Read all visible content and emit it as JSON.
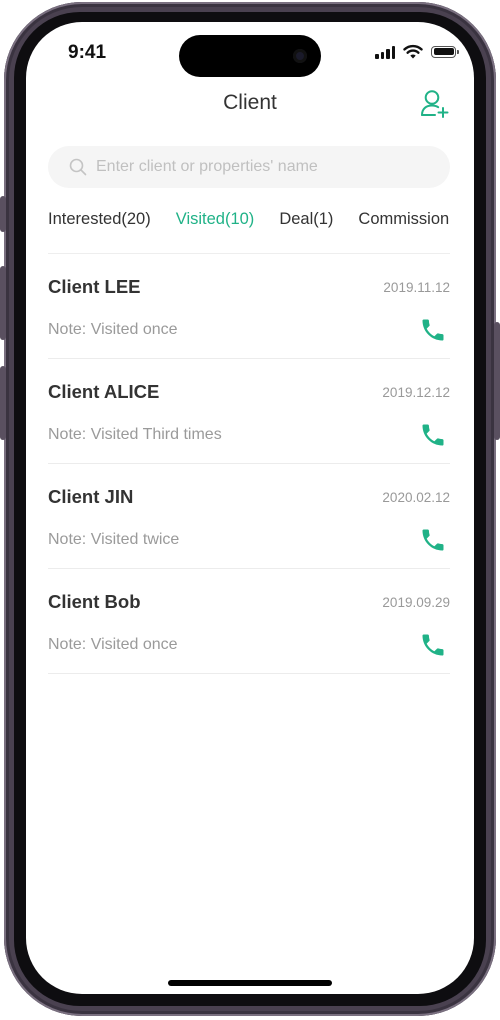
{
  "status_bar": {
    "time": "9:41"
  },
  "header": {
    "title": "Client",
    "add_client_icon": "person-add-icon"
  },
  "search": {
    "placeholder": "Enter client or properties' name",
    "value": ""
  },
  "tabs": [
    {
      "label": "Interested(20)",
      "active": false
    },
    {
      "label": "Visited(10)",
      "active": true
    },
    {
      "label": "Deal(1)",
      "active": false
    },
    {
      "label": "Commission",
      "active": false
    }
  ],
  "clients": [
    {
      "name": "Client LEE",
      "date": "2019.11.12",
      "note": "Note: Visited once"
    },
    {
      "name": "Client ALICE",
      "date": "2019.12.12",
      "note": "Note: Visited Third times"
    },
    {
      "name": "Client JIN",
      "date": "2020.02.12",
      "note": "Note: Visited twice"
    },
    {
      "name": "Client Bob",
      "date": "2019.09.29",
      "note": "Note: Visited once"
    }
  ],
  "colors": {
    "accent": "#20b287",
    "text_primary": "#333333",
    "text_secondary": "#9a9a9a",
    "search_bg": "#f5f5f5"
  }
}
